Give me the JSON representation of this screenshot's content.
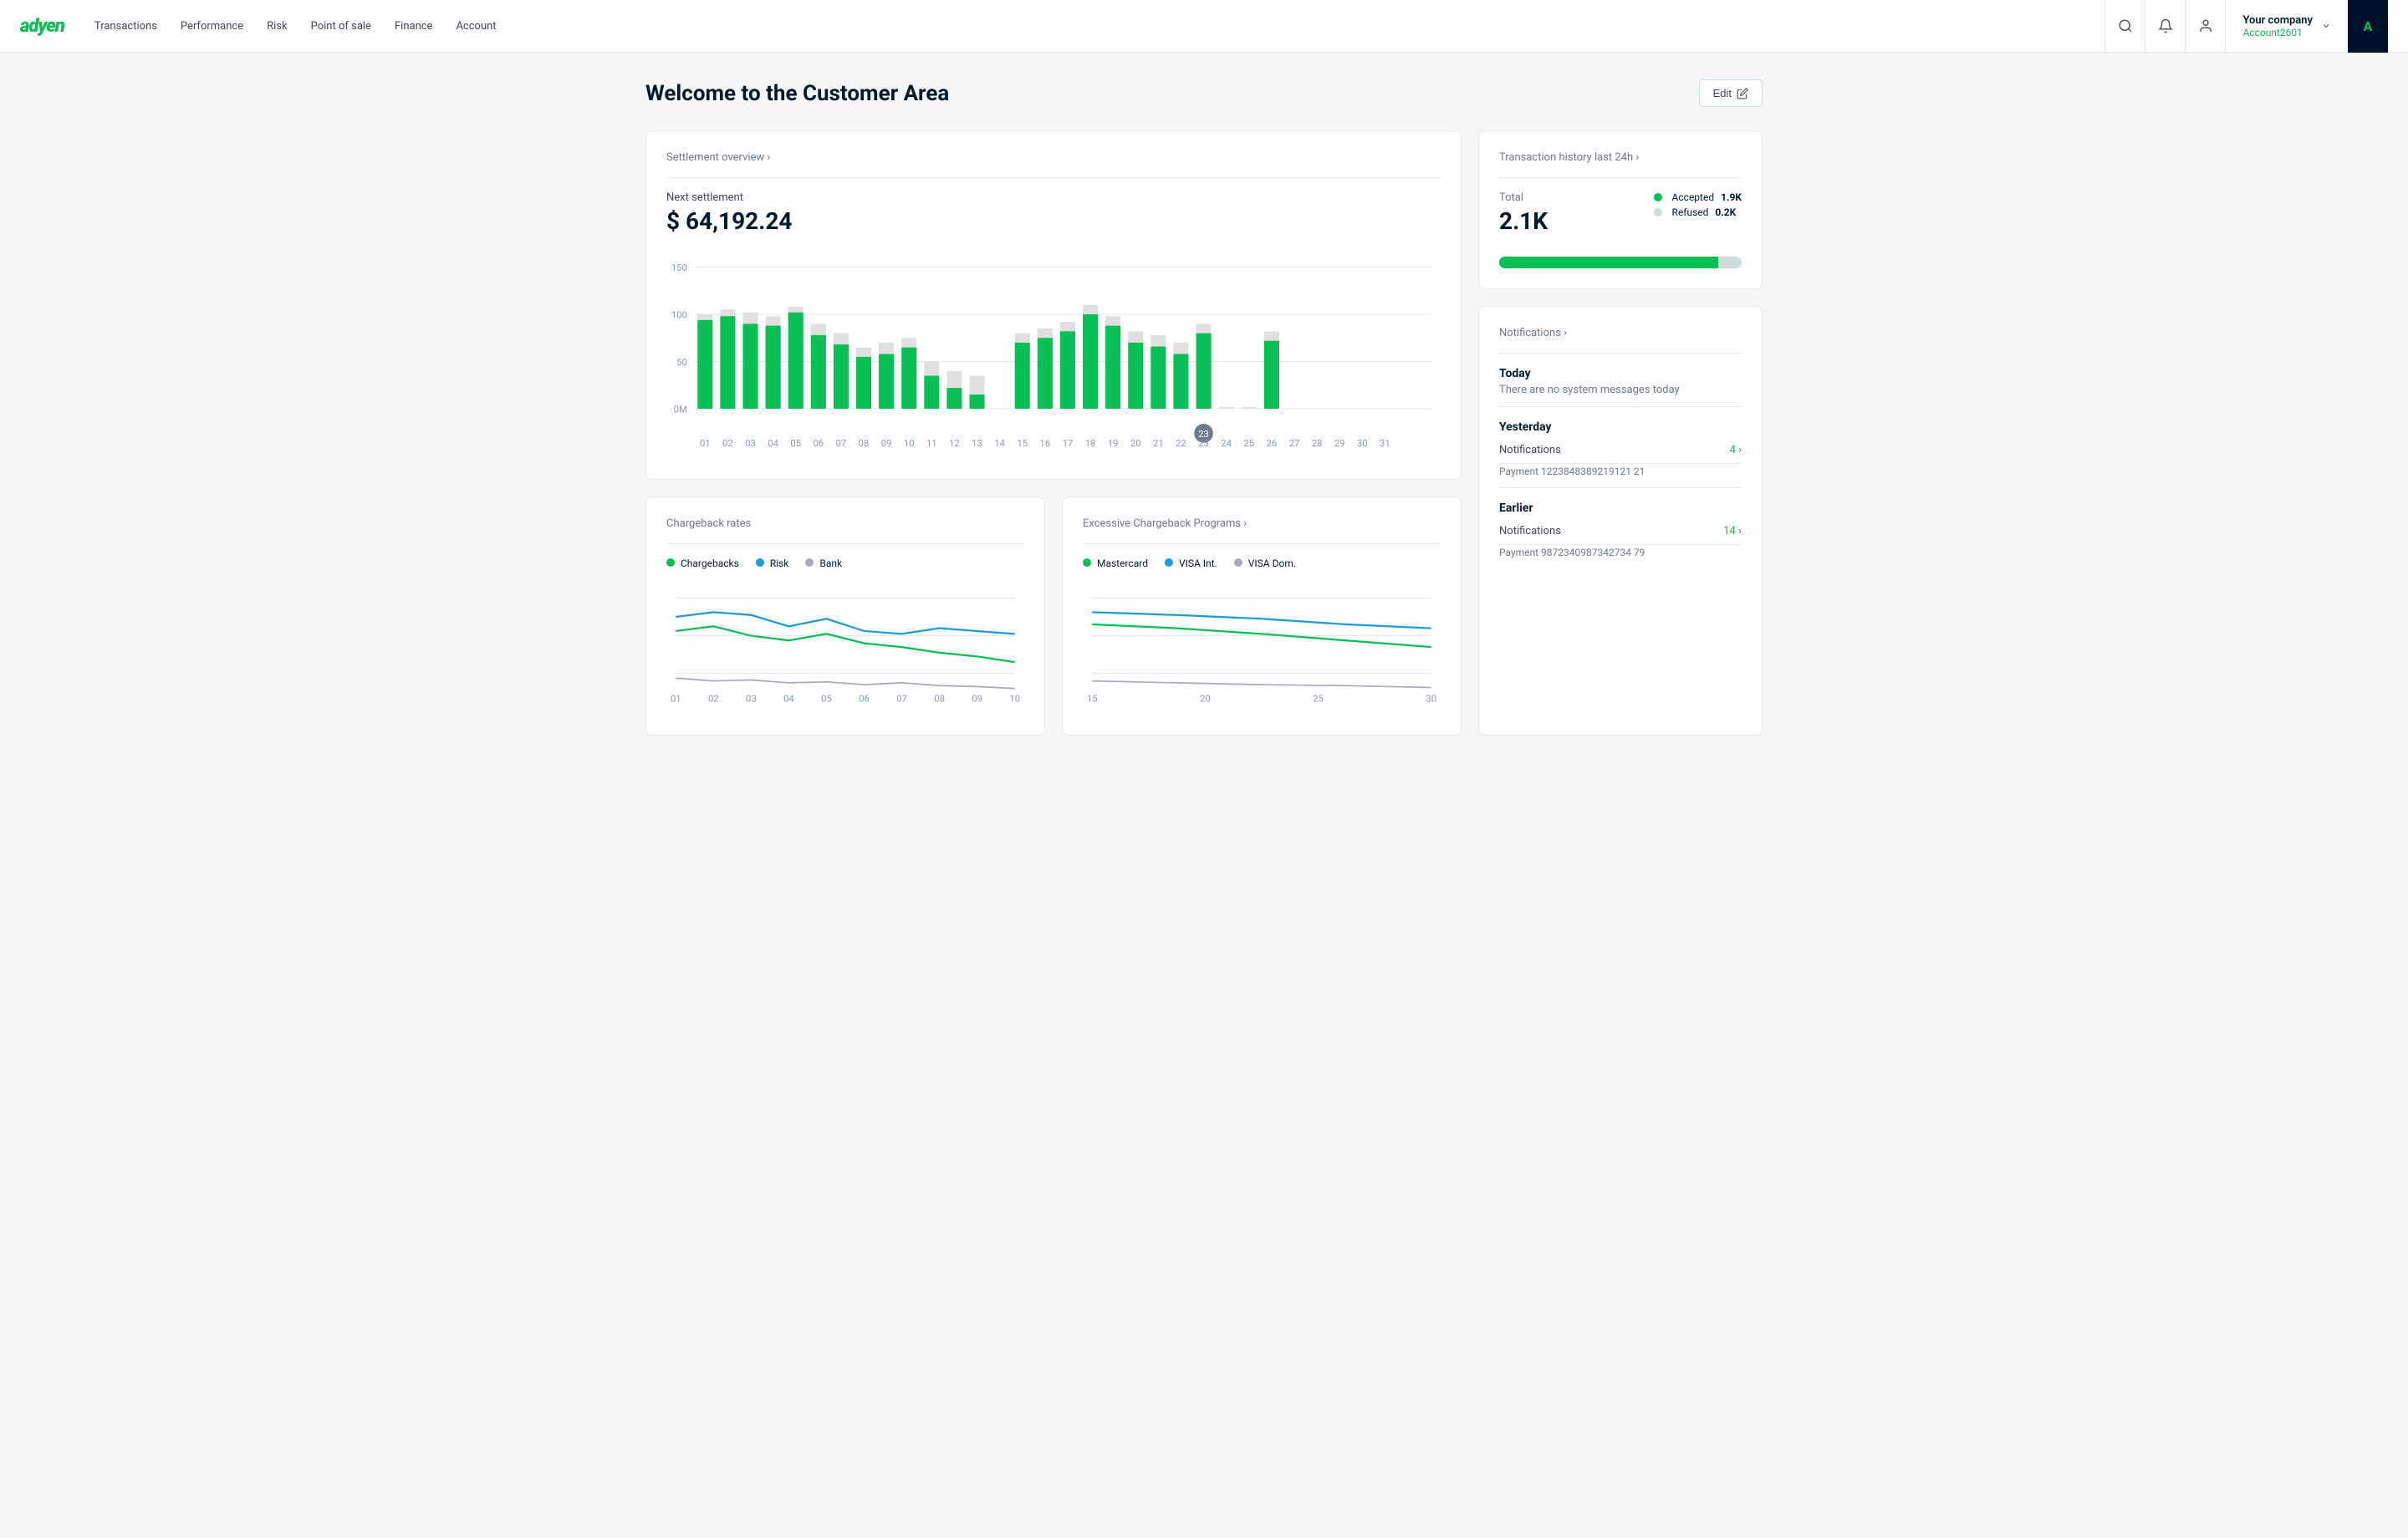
{
  "nav": {
    "logo": "adyen",
    "links": [
      "Transactions",
      "Performance",
      "Risk",
      "Point of sale",
      "Finance",
      "Account"
    ],
    "company_name": "Your company",
    "account_id": "Account2601",
    "avatar_letter": "A"
  },
  "page": {
    "title": "Welcome to the Customer Area",
    "edit_label": "Edit"
  },
  "settlement": {
    "title": "Settlement overview ›",
    "next_label": "Next settlement",
    "amount": "$ 64,192.24",
    "y_labels": [
      "150",
      "100",
      "50",
      "0M"
    ],
    "x_labels": [
      "01",
      "02",
      "03",
      "04",
      "05",
      "06",
      "07",
      "08",
      "09",
      "10",
      "11",
      "12",
      "13",
      "14",
      "15",
      "16",
      "17",
      "18",
      "19",
      "20",
      "21",
      "22",
      "23",
      "24",
      "25",
      "26",
      "27",
      "28",
      "29",
      "30",
      "31"
    ]
  },
  "chargeback": {
    "title": "Chargeback rates",
    "legend": [
      {
        "label": "Chargebacks",
        "color": "#0abf53"
      },
      {
        "label": "Risk",
        "color": "#1a9bdc"
      },
      {
        "label": "Bank",
        "color": "#aab"
      }
    ],
    "x_labels": [
      "01",
      "02",
      "03",
      "04",
      "05",
      "06",
      "07",
      "08",
      "09",
      "10"
    ]
  },
  "excessive_chargeback": {
    "title": "Excessive Chargeback Programs ›",
    "legend": [
      {
        "label": "Mastercard",
        "color": "#0abf53"
      },
      {
        "label": "VISA Int.",
        "color": "#1a9bdc"
      },
      {
        "label": "VISA Dom.",
        "color": "#aab"
      }
    ],
    "x_labels": [
      "15",
      "20",
      "25",
      "30"
    ]
  },
  "transaction_history": {
    "title": "Transaction history last 24h ›",
    "total_label": "Total",
    "total_value": "2.1K",
    "accepted_label": "Accepted",
    "accepted_value": "1.9K",
    "refused_label": "Refused",
    "refused_value": "0.2K"
  },
  "notifications": {
    "title": "Notifications ›",
    "today": {
      "label": "Today",
      "message": "There are no system messages today"
    },
    "yesterday": {
      "label": "Yesterday",
      "notif_label": "Notifications",
      "notif_count": "4 ›",
      "payment_label": "Payment 1223848389219121 21"
    },
    "earlier": {
      "label": "Earlier",
      "notif_label": "Notifications",
      "notif_count": "14 ›",
      "payment_label": "Payment 9872340987342734 79"
    }
  }
}
